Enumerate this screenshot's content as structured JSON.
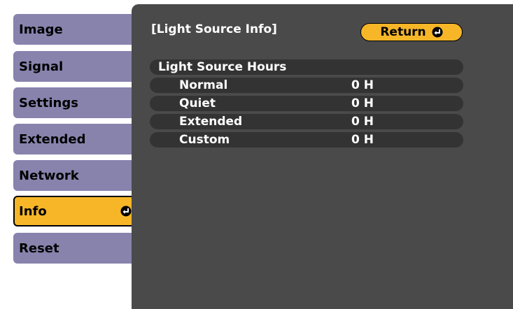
{
  "menu": {
    "items": [
      {
        "label": "Image"
      },
      {
        "label": "Signal"
      },
      {
        "label": "Settings"
      },
      {
        "label": "Extended"
      },
      {
        "label": "Network"
      },
      {
        "label": "Info",
        "active": true
      },
      {
        "label": "Reset"
      }
    ]
  },
  "panel": {
    "title": "[Light Source Info]",
    "return_label": "Return",
    "section_label": "Light Source Hours",
    "rows": [
      {
        "label": "Normal",
        "value": "0 H"
      },
      {
        "label": "Quiet",
        "value": "0 H"
      },
      {
        "label": "Extended",
        "value": "0 H"
      },
      {
        "label": "Custom",
        "value": "0 H"
      }
    ]
  },
  "colors": {
    "menu_item": "#8783ad",
    "accent": "#f6b628",
    "panel": "#4a4a4a",
    "row": "#333333"
  },
  "icons": {
    "enter": "enter-icon"
  }
}
